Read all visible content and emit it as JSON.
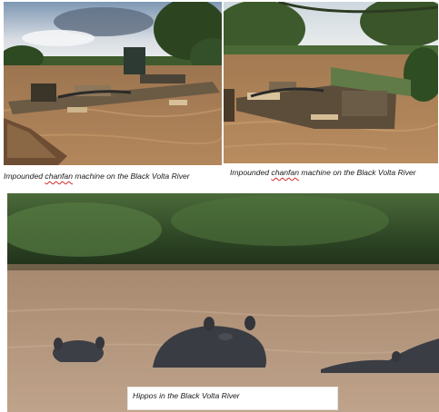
{
  "captions": [
    {
      "prefix": "Impounded ",
      "flagged": "chanfan",
      "suffix": " machine on the Black Volta River"
    },
    {
      "prefix": "Impounded ",
      "flagged": "chanfan",
      "suffix": " machine on the Black Volta River"
    },
    {
      "text": "Hippos in the Black Volta River"
    }
  ],
  "colors": {
    "river_water": "#a8825a",
    "hippo_water": "#b39379",
    "forest": "#2f4a25",
    "spellcheck_underline": "#d12a2a"
  }
}
